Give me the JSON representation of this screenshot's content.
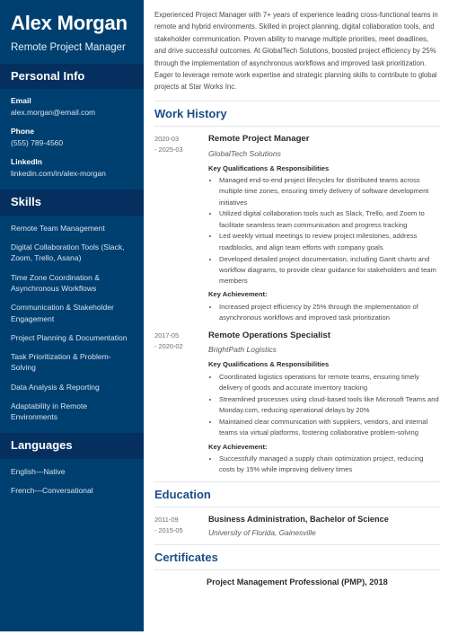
{
  "sidebar": {
    "name": "Alex Morgan",
    "job_title": "Remote Project Manager",
    "personal_info": {
      "heading": "Personal Info",
      "items": [
        {
          "label": "Email",
          "value": "alex.morgan@email.com"
        },
        {
          "label": "Phone",
          "value": "(555) 789-4560"
        },
        {
          "label": "LinkedIn",
          "value": "linkedin.com/in/alex-morgan"
        }
      ]
    },
    "skills": {
      "heading": "Skills",
      "items": [
        "Remote Team Management",
        "Digital Collaboration Tools (Slack, Zoom, Trello, Asana)",
        "Time Zone Coordination & Asynchronous Workflows",
        "Communication & Stakeholder Engagement",
        "Project Planning & Documentation",
        "Task Prioritization & Problem-Solving",
        "Data Analysis & Reporting",
        "Adaptability in Remote Environments"
      ]
    },
    "languages": {
      "heading": "Languages",
      "items": [
        "English—Native",
        "French—Conversational"
      ]
    }
  },
  "main": {
    "summary": "Experienced Project Manager with 7+ years of experience leading cross-functional teams in remote and hybrid environments. Skilled in project planning, digital collaboration tools, and stakeholder communication. Proven ability to manage multiple priorities, meet deadlines, and drive successful outcomes. At GlobalTech Solutions, boosted project efficiency by 25% through the implementation of asynchronous workflows and improved task prioritization. Eager to leverage remote work expertise and strategic planning skills to contribute to global projects at Star Works Inc.",
    "work_history": {
      "heading": "Work History",
      "entries": [
        {
          "date_start": "2020-03",
          "date_end": "- 2025-03",
          "role": "Remote Project Manager",
          "organization": "GlobalTech Solutions",
          "qualifications_label": "Key Qualifications & Responsibilities",
          "qualifications": [
            "Managed end-to-end project lifecycles for distributed teams across multiple time zones, ensuring timely delivery of software development initiatives",
            "Utilized digital collaboration tools such as Slack, Trello, and Zoom to facilitate seamless team communication and progress tracking",
            "Led weekly virtual meetings to review project milestones, address roadblocks, and align team efforts with company goals",
            "Developed detailed project documentation, including Gantt charts and workflow diagrams, to provide clear guidance for stakeholders and team members"
          ],
          "achievement_label": "Key Achievement:",
          "achievements": [
            "Increased project efficiency by 25% through the implementation of asynchronous workflows and improved task prioritization"
          ]
        },
        {
          "date_start": "2017-05",
          "date_end": "- 2020-02",
          "role": "Remote Operations Specialist",
          "organization": "BrightPath Logistics",
          "qualifications_label": "Key Qualifications & Responsibilities",
          "qualifications": [
            "Coordinated logistics operations for remote teams, ensuring timely delivery of goods and accurate inventory tracking",
            "Streamlined processes using cloud-based tools like Microsoft Teams and Monday.com, reducing operational delays by 20%",
            "Maintained clear communication with suppliers, vendors, and internal teams via virtual platforms, fostering collaborative problem-solving"
          ],
          "achievement_label": "Key Achievement:",
          "achievements": [
            "Successfully managed a supply chain optimization project, reducing costs by 15% while improving delivery times"
          ]
        }
      ]
    },
    "education": {
      "heading": "Education",
      "entries": [
        {
          "date_start": "2011-09",
          "date_end": "- 2015-05",
          "degree": "Business Administration, Bachelor of Science",
          "school": "University of Florida, Gainesville"
        }
      ]
    },
    "certificates": {
      "heading": "Certificates",
      "entries": [
        {
          "name": "Project Management Professional (PMP), 2018"
        }
      ]
    }
  },
  "colors": {
    "sidebar_bg": "#004071",
    "sidebar_band": "#042f5e",
    "heading_accent": "#1a4f87"
  }
}
